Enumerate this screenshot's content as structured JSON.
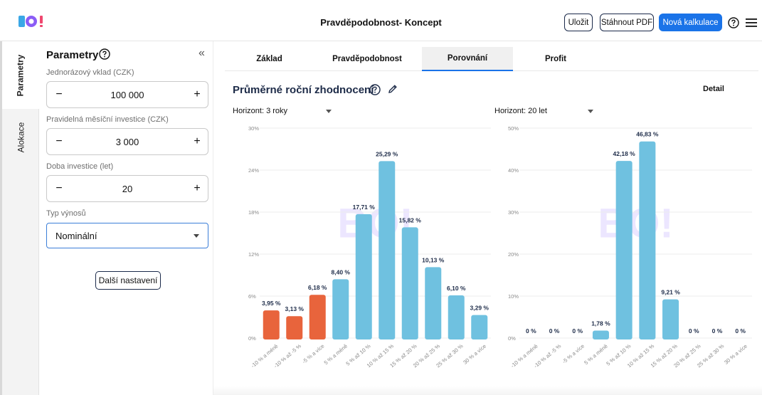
{
  "header": {
    "title": "Pravděpodobnost- Koncept",
    "save_label": "Uložit",
    "pdf_label": "Stáhnout PDF",
    "new_label": "Nová kalkulace"
  },
  "side_tabs": [
    "Parametry",
    "Alokace"
  ],
  "params": {
    "title": "Parametry",
    "collapse_glyph": "«",
    "fields": [
      {
        "label": "Jednorázový vklad (CZK)",
        "value": "100 000"
      },
      {
        "label": "Pravidelná měsíční investice (CZK)",
        "value": "3 000"
      },
      {
        "label": "Doba investice (let)",
        "value": "20"
      }
    ],
    "minus": "−",
    "plus": "+",
    "yield_label": "Typ výnosů",
    "yield_value": "Nominální",
    "more_label": "Další nastavení"
  },
  "tabs": [
    "Základ",
    "Pravděpodobnost",
    "Porovnání",
    "Profit"
  ],
  "active_tab": "Porovnání",
  "section": {
    "title": "Průměrné roční zhodnocení",
    "detail": "Detail"
  },
  "colors": {
    "negative": "#e8643c",
    "positive": "#6fc1e0",
    "accent": "#1a73e8",
    "navy": "#1d2b48"
  },
  "chart_data": [
    {
      "type": "bar",
      "horizon": "Horizont: 3 roky",
      "categories": [
        "-10 % a méně",
        "-10 % až -5 %",
        "-5 % a více",
        "5 % a méně",
        "5 % až 10 %",
        "10 % až 15 %",
        "15 % až 20 %",
        "20 % až 25 %",
        "25 % až 30 %",
        "30 % a více"
      ],
      "values": [
        3.95,
        3.13,
        6.18,
        8.4,
        17.71,
        25.29,
        15.82,
        10.13,
        6.1,
        3.29
      ],
      "value_labels": [
        "3,95 %",
        "3,13 %",
        "6,18 %",
        "8,40 %",
        "17,71 %",
        "25,29 %",
        "15,82 %",
        "10,13 %",
        "6,10 %",
        "3,29 %"
      ],
      "colors": [
        "negative",
        "negative",
        "negative",
        "positive",
        "positive",
        "positive",
        "positive",
        "positive",
        "positive",
        "positive"
      ],
      "ylim": [
        0,
        30
      ],
      "yticks": [
        "0%",
        "6%",
        "12%",
        "18%",
        "24%",
        "30%"
      ],
      "grid": true
    },
    {
      "type": "bar",
      "horizon": "Horizont: 20 let",
      "categories": [
        "-10 % a méně",
        "-10 % až -5 %",
        "-5 % a více",
        "5 % a méně",
        "5 % až 10 %",
        "10 % až 15 %",
        "15 % až 20 %",
        "20 % až 25 %",
        "25 % až 30 %",
        "30 % a více"
      ],
      "values": [
        0,
        0,
        0,
        1.78,
        42.18,
        46.83,
        9.21,
        0,
        0,
        0
      ],
      "value_labels": [
        "0 %",
        "0 %",
        "0 %",
        "1,78 %",
        "42,18 %",
        "46,83 %",
        "9,21 %",
        "0 %",
        "0 %",
        "0 %"
      ],
      "colors": [
        "negative",
        "negative",
        "negative",
        "positive",
        "positive",
        "positive",
        "positive",
        "positive",
        "positive",
        "positive"
      ],
      "ylim": [
        0,
        50
      ],
      "yticks": [
        "0%",
        "10%",
        "20%",
        "30%",
        "40%",
        "50%"
      ],
      "grid": true
    }
  ]
}
